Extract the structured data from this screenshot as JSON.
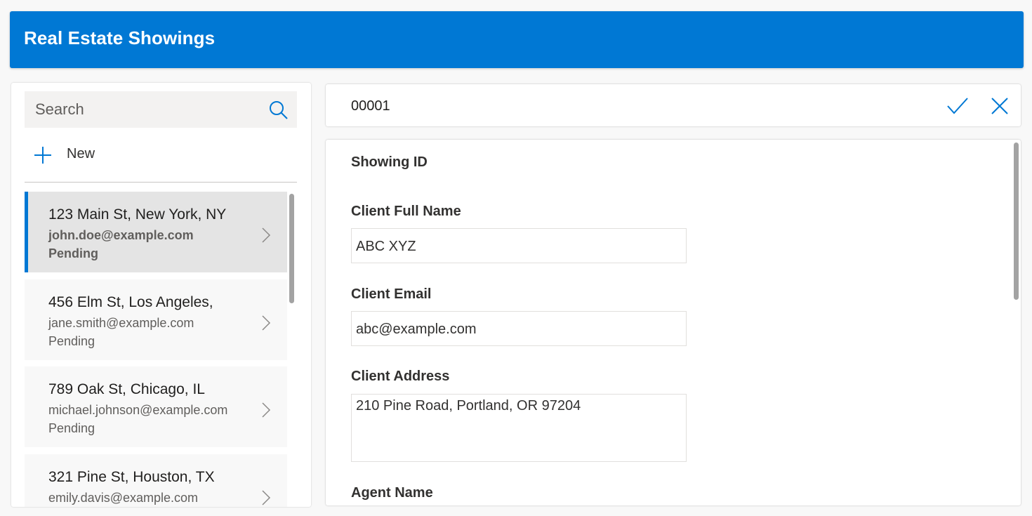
{
  "app": {
    "title": "Real Estate Showings"
  },
  "search": {
    "placeholder": "Search",
    "icon": "search-icon"
  },
  "new_button": {
    "label": "New",
    "icon": "plus-icon"
  },
  "showings": [
    {
      "address": "123 Main St, New York, NY",
      "email": "john.doe@example.com",
      "status": "Pending",
      "selected": true
    },
    {
      "address": "456 Elm St, Los Angeles,",
      "email": "jane.smith@example.com",
      "status": "Pending",
      "selected": false
    },
    {
      "address": "789 Oak St, Chicago, IL",
      "email": "michael.johnson@example.com",
      "status": "Pending",
      "selected": false
    },
    {
      "address": "321 Pine St, Houston, TX",
      "email": "emily.davis@example.com",
      "status": "",
      "selected": false
    }
  ],
  "record": {
    "id": "00001",
    "actions": {
      "save_icon": "checkmark-icon",
      "cancel_icon": "close-icon"
    }
  },
  "form": {
    "showing_id_label": "Showing ID",
    "client_full_name_label": "Client Full Name",
    "client_full_name_value": "ABC XYZ",
    "client_email_label": "Client Email",
    "client_email_value": "abc@example.com",
    "client_address_label": "Client Address",
    "client_address_value": "210 Pine Road, Portland, OR 97204",
    "agent_name_label": "Agent Name"
  },
  "colors": {
    "accent": "#0078d4",
    "header_text": "#ffffff",
    "selected_row": "#e4e4e4",
    "row": "#f8f8f8"
  }
}
